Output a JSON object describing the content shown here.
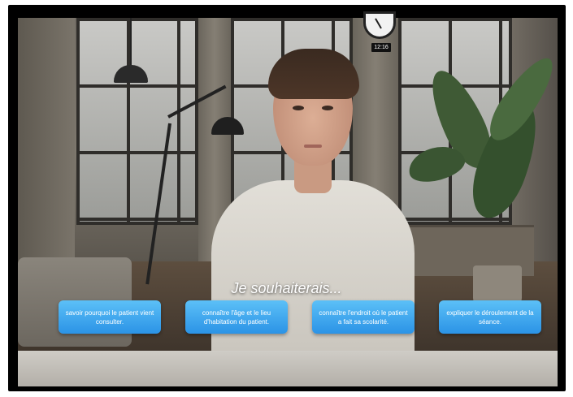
{
  "clock": {
    "time": "12:16"
  },
  "dialogue": {
    "prompt": "Je souhaiterais...",
    "choices": [
      {
        "label": "savoir pourquoi le patient vient consulter."
      },
      {
        "label": "connaître l'âge et le lieu d'habitation du patient."
      },
      {
        "label": "connaître l'endroit où le patient a fait sa scolarité."
      },
      {
        "label": "expliquer le déroulement de la séance."
      }
    ]
  }
}
